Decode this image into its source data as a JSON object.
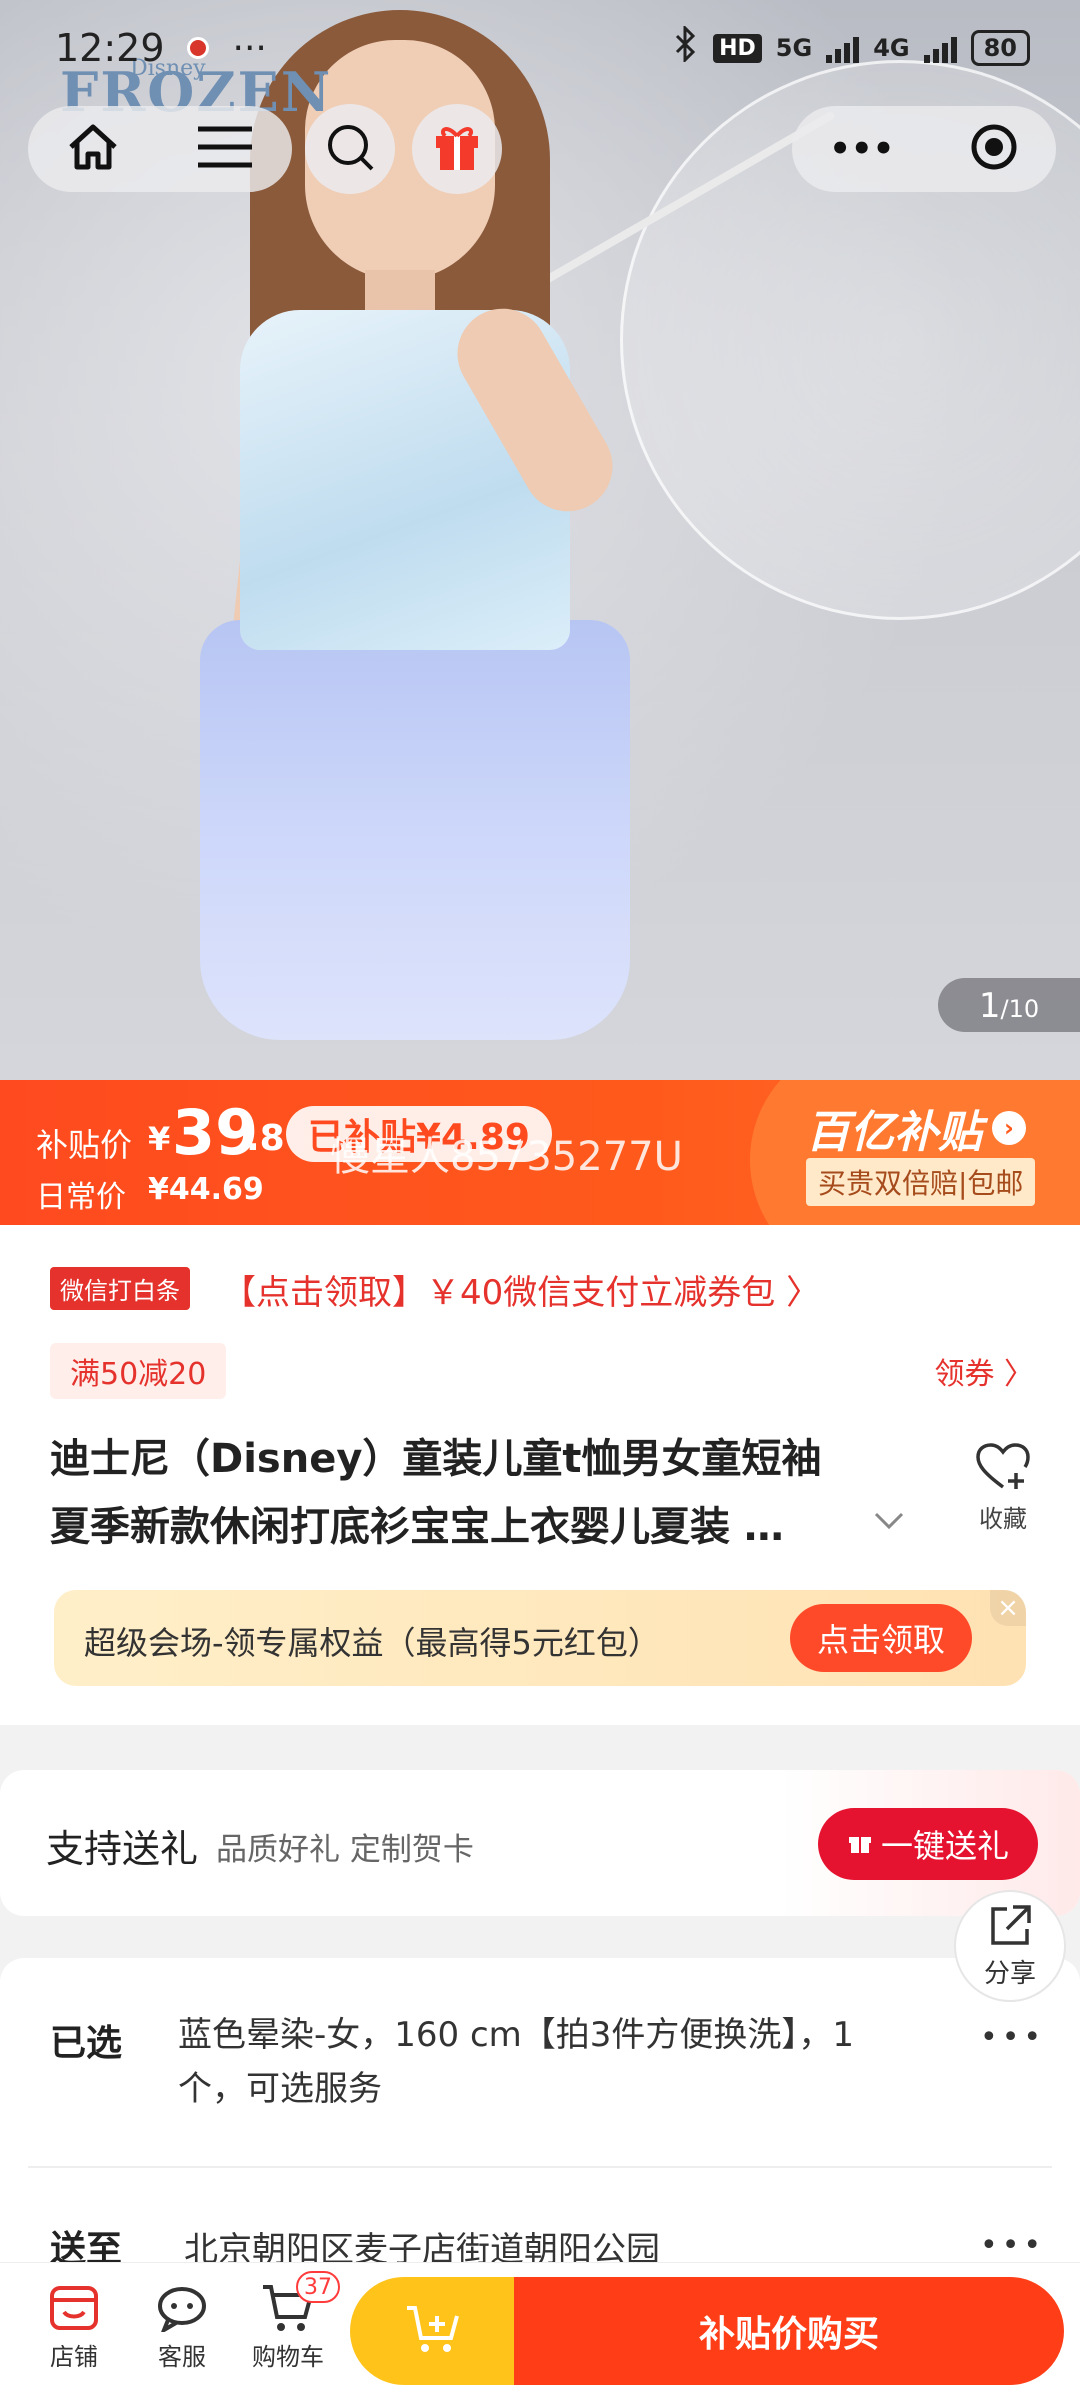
{
  "status_bar": {
    "time": "12:29",
    "more": "···",
    "hd": "HD",
    "net1": "5G",
    "net2": "4G",
    "battery": "80"
  },
  "hero": {
    "brand_small": "Disney",
    "brand_logo": "FROZEN",
    "counter_current": "1",
    "counter_total": "/10"
  },
  "nav": {
    "menu_dots": "•••"
  },
  "price_banner": {
    "subsidy_label": "补贴价",
    "yen": "¥",
    "price_int": "39",
    "price_dec": ".8",
    "subsidized": "已补贴¥4.89",
    "daily_label": "日常价",
    "daily_price": "¥44.69",
    "watermark": "慢星人85735277U",
    "brand": "百亿补贴",
    "brand_arrow": "›",
    "guarantee": "买贵双倍赔|包邮"
  },
  "promo": {
    "wechat_tag": "微信打白条",
    "wechat_text": "【点击领取】￥40微信支付立减券包 〉",
    "discount_tag": "满50减20",
    "coupon_link": "领券 〉"
  },
  "product": {
    "title_line1": "迪士尼（Disney）童装儿童t恤男女童短袖",
    "title_line2": "夏季新款休闲打底衫宝宝上衣婴儿夏装 …",
    "favorite_label": "收藏"
  },
  "venue_banner": {
    "text": "超级会场-领专属权益（最高得5元红包）",
    "button": "点击领取",
    "close": "×"
  },
  "gift": {
    "title": "支持送礼",
    "subtitle": "品质好礼 定制贺卡",
    "button": "一键送礼"
  },
  "share": {
    "label": "分享"
  },
  "selection": {
    "label": "已选",
    "value": "蓝色晕染-女，160 cm【拍3件方便换洗】，1个，可选服务",
    "ship_label": "送至",
    "ship_value": "北京朝阳区麦子店街道朝阳公园"
  },
  "bottom_bar": {
    "store": "店铺",
    "service": "客服",
    "cart": "购物车",
    "cart_count": "37",
    "buy": "补贴价购买"
  },
  "colors": {
    "accent": "#ff4a1f",
    "red": "#e5322c",
    "yellow": "#ffc31a"
  }
}
